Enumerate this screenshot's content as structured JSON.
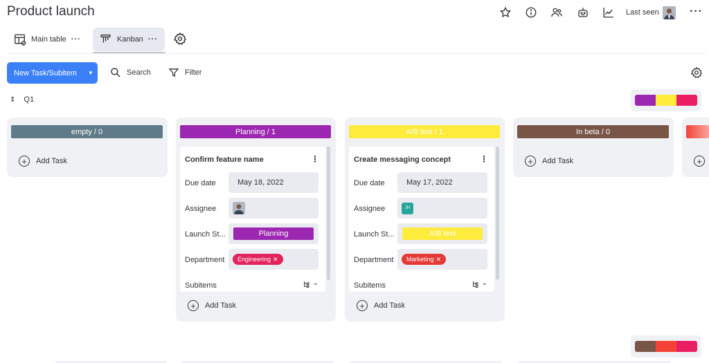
{
  "header": {
    "title": "Product launch",
    "last_seen_label": "Last seen",
    "icons": [
      "star-icon",
      "info-icon",
      "people-icon",
      "robot-icon",
      "activity-chart-icon"
    ],
    "more": "···"
  },
  "tabs": [
    {
      "label": "Main table",
      "dots": "···",
      "icon": "table-icon"
    },
    {
      "label": "Kanban",
      "dots": "···",
      "icon": "kanban-icon"
    }
  ],
  "toolbar": {
    "new_button": "New Task/Subitem",
    "search": "Search",
    "filter": "Filter"
  },
  "group": {
    "label": "Q1"
  },
  "colors": {
    "empty": "#5f7b89",
    "planning": "#9c27b0",
    "abtest": "#ffeb3b",
    "inbeta": "#795548",
    "next": "#f44336",
    "engineering": "#e2235d",
    "marketing": "#e53935",
    "accent": "#3b80f6"
  },
  "swatches_top": [
    "#9c27b0",
    "#ffeb3b",
    "#e91e63"
  ],
  "swatches_bottom": [
    "#795548",
    "#f44336",
    "#e91e63"
  ],
  "columns": [
    {
      "header": "empty / 0",
      "add_task": "Add Task"
    },
    {
      "header": "Planning / 1",
      "add_task": "Add Task",
      "card": {
        "title": "Confirm feature name",
        "fields": {
          "due_label": "Due date",
          "due_value": "May 18, 2022",
          "assignee_label": "Assignee",
          "status_label": "Launch St...",
          "status_value": "Planning",
          "department_label": "Department",
          "department_value": "Engineering",
          "subitems_label": "Subitems"
        }
      }
    },
    {
      "header": "A/B test / 1",
      "add_task": "Add Task",
      "card": {
        "title": "Create messaging concept",
        "fields": {
          "due_label": "Due date",
          "due_value": "May 17, 2022",
          "assignee_label": "Assignee",
          "assignee_initials": "JH",
          "status_label": "Launch St...",
          "status_value": "A/B test",
          "department_label": "Department",
          "department_value": "Marketing",
          "subitems_label": "Subitems"
        }
      }
    },
    {
      "header": "In beta / 0",
      "add_task": "Add Task"
    }
  ],
  "glyphs": {
    "close": "✕",
    "plus": "+",
    "caret": "▼",
    "chevron": "⌄",
    "vdots": "⋮",
    "updown": "⇕"
  }
}
